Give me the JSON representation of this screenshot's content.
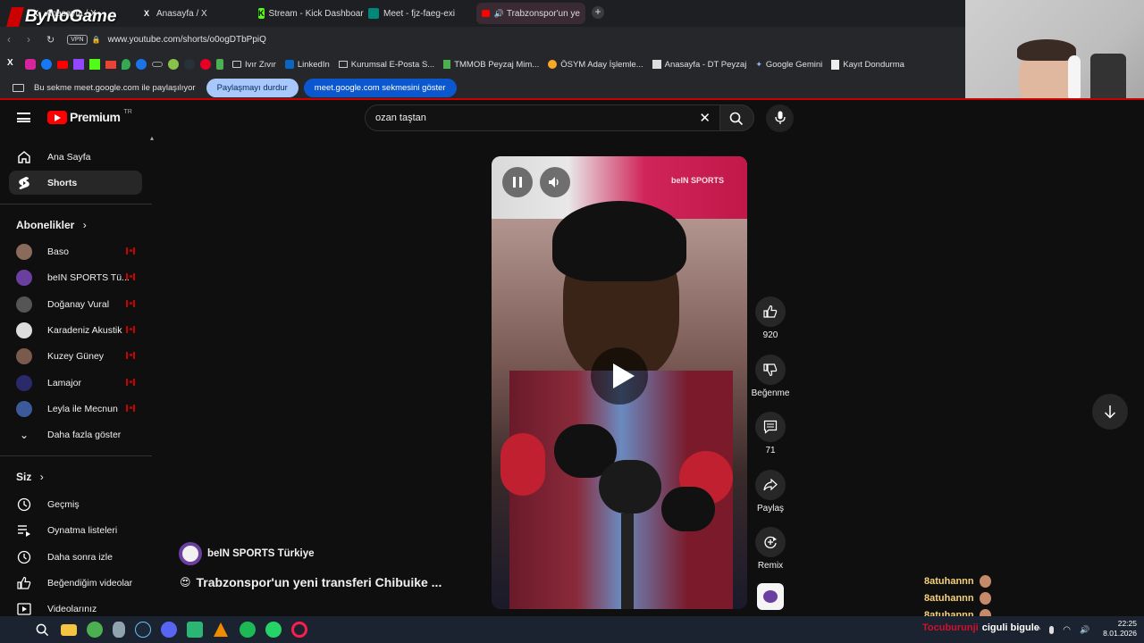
{
  "overlay": {
    "brand": "ByNoGame"
  },
  "tabs": [
    {
      "label": "Anasayfa / X",
      "favicon": "x-icon"
    },
    {
      "label": "Anasayfa / X",
      "favicon": "x-icon"
    },
    {
      "label": "Stream - Kick Dashboard",
      "favicon": "kick-icon"
    },
    {
      "label": "Meet - fjz-faeg-exi",
      "favicon": "meet-icon"
    },
    {
      "label": "Trabzonspor'un ye",
      "favicon": "youtube-icon"
    }
  ],
  "address": {
    "url": "www.youtube.com/shorts/o0ogDTbPpiQ",
    "vpn": "VPN"
  },
  "bookmarks": [
    "Ivır Zıvır",
    "LinkedIn",
    "Kurumsal E-Posta S...",
    "TMMOB Peyzaj Mim...",
    "ÖSYM Aday İşlemle...",
    "Anasayfa - DT Peyzaj",
    "Google Gemini",
    "Kayıt Dondurma"
  ],
  "sharebar": {
    "message": "Bu sekme meet.google.com ile paylaşılıyor",
    "stop_label": "Paylaşmayı durdur",
    "show_label": "meet.google.com sekmesini göster"
  },
  "youtube": {
    "logo_text": "Premium",
    "region": "TR",
    "search_value": "ozan taştan"
  },
  "sidebar": {
    "main": [
      {
        "label": "Ana Sayfa",
        "icon": "home-icon"
      },
      {
        "label": "Shorts",
        "icon": "shorts-icon"
      }
    ],
    "subs_title": "Abonelikler",
    "subscriptions": [
      {
        "label": "Baso",
        "color": "#8a6a5a"
      },
      {
        "label": "beIN SPORTS Tü...",
        "color": "#6b3fa0"
      },
      {
        "label": "Doğanay Vural",
        "color": "#555555"
      },
      {
        "label": "Karadeniz Akustik",
        "color": "#dddddd"
      },
      {
        "label": "Kuzey Güney",
        "color": "#7a5a4a"
      },
      {
        "label": "Lamajor",
        "color": "#2a2a6a"
      },
      {
        "label": "Leyla ile Mecnun",
        "color": "#3a5a9a"
      }
    ],
    "show_more": "Daha fazla göster",
    "you_title": "Siz",
    "you_items": [
      {
        "label": "Geçmiş",
        "icon": "history-icon"
      },
      {
        "label": "Oynatma listeleri",
        "icon": "playlist-icon"
      },
      {
        "label": "Daha sonra izle",
        "icon": "clock-icon"
      },
      {
        "label": "Beğendiğim videolar",
        "icon": "thumbs-up-icon"
      },
      {
        "label": "Videolarınız",
        "icon": "video-icon"
      }
    ]
  },
  "short": {
    "channel": "beIN SPORTS Türkiye",
    "title": "Trabzonspor'un yeni transferi Chibuike ...",
    "title_emoji": "😍",
    "watermark": "beIN SPORTS",
    "likes": "920",
    "dislike_label": "Beğenme",
    "comments": "71",
    "share_label": "Paylaş",
    "remix_label": "Remix"
  },
  "chat": {
    "messages": [
      "8atuhannn",
      "8atuhannn",
      "8atuhannn"
    ],
    "last_user": "Tocuburunji",
    "last_message": "ciguli bigule"
  },
  "clock": {
    "time": "22:25",
    "date": "8.01.2026"
  },
  "colors": {
    "accent": "#ff0000",
    "share_stop": "#a8c7fa",
    "share_show": "#0b57d0"
  }
}
